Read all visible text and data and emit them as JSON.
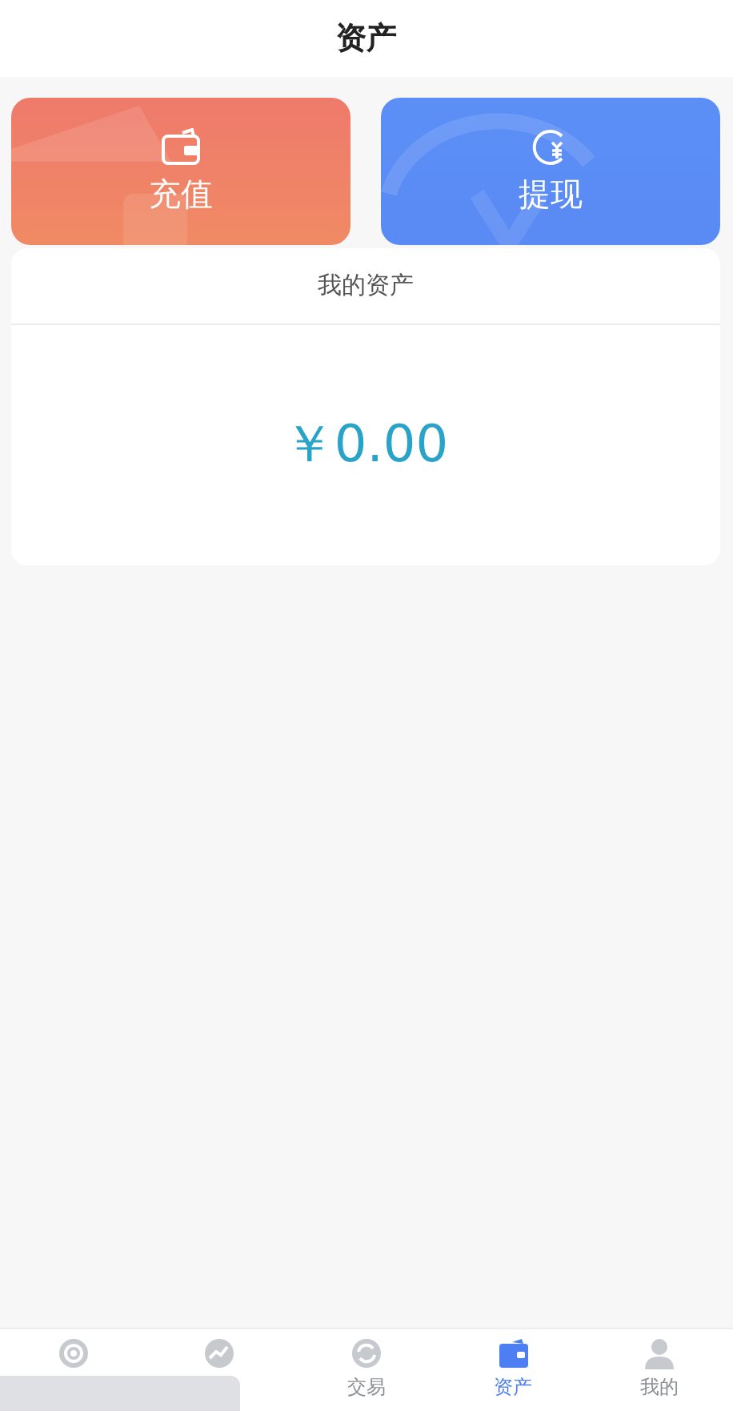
{
  "header": {
    "title": "资产"
  },
  "actions": [
    {
      "kind": "recharge",
      "label": "充值"
    },
    {
      "kind": "withdraw",
      "label": "提现"
    }
  ],
  "assets": {
    "title": "我的资产",
    "amount": "￥0.00"
  },
  "tab_bar": [
    {
      "kind": "target",
      "selected": false
    },
    {
      "kind": "trend",
      "selected": false
    },
    {
      "kind": "exchange",
      "label": "交易",
      "selected": false
    },
    {
      "kind": "wallet",
      "label": "资产",
      "selected": true
    },
    {
      "kind": "user",
      "label": "我的",
      "selected": false
    }
  ]
}
